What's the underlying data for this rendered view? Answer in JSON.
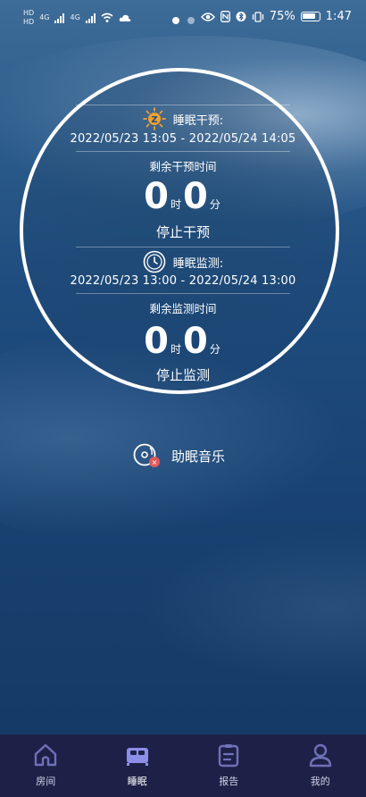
{
  "status_bar": {
    "network_label_1": "4G",
    "network_label_2": "4G",
    "sim1": "HD",
    "sim2": "HD",
    "battery": "75%",
    "time": "1:47"
  },
  "pages": {
    "count": 2,
    "active_index": 0
  },
  "intervention": {
    "title": "睡眠干预:",
    "range": "2022/05/23 13:05 - 2022/05/24 14:05",
    "remaining_label": "剩余干预时间",
    "hours": "0",
    "hours_unit": "时",
    "minutes": "0",
    "minutes_unit": "分",
    "action": "停止干预"
  },
  "monitoring": {
    "title": "睡眠监测:",
    "range": "2022/05/23 13:00 - 2022/05/24 13:00",
    "remaining_label": "剩余监测时间",
    "hours": "0",
    "hours_unit": "时",
    "minutes": "0",
    "minutes_unit": "分",
    "action": "停止监测"
  },
  "music": {
    "label": "助眠音乐",
    "icon": "music-disc-icon",
    "badge_color": "#e05a5a"
  },
  "nav": {
    "items": [
      {
        "label": "房间",
        "icon": "home-icon"
      },
      {
        "label": "睡眠",
        "icon": "bed-icon"
      },
      {
        "label": "报告",
        "icon": "clipboard-icon"
      },
      {
        "label": "我的",
        "icon": "user-icon"
      }
    ],
    "active_index": 1,
    "active_color": "#8d8ee8",
    "inactive_color": "#6e71b8"
  },
  "colors": {
    "accent_orange": "#f0a030",
    "nav_bg": "#1e2147"
  }
}
